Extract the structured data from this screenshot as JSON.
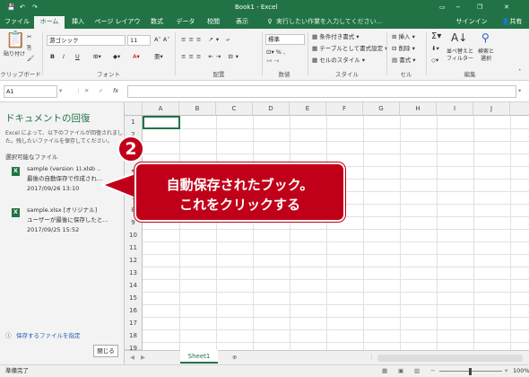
{
  "titlebar": {
    "title": "Book1 - Excel",
    "signin": "サインイン",
    "share": "共有",
    "min": "−",
    "restore": "❐",
    "close": "✕"
  },
  "tabs": [
    "ファイル",
    "ホーム",
    "挿入",
    "ページ レイアウト",
    "数式",
    "データ",
    "校閲",
    "表示"
  ],
  "tell_me": "実行したい作業を入力してください...",
  "ribbon": {
    "paste": "貼り付け",
    "clipboard": "クリップボード",
    "font_name": "游ゴシック",
    "font_size": "11",
    "bold": "B",
    "italic": "I",
    "underline": "U",
    "font": "フォント",
    "alignment": "配置",
    "number_format": "標準",
    "number": "数値",
    "cond_format": "条件付き書式",
    "table_format": "テーブルとして書式設定",
    "cell_style": "セルのスタイル",
    "style": "スタイル",
    "insert": "挿入",
    "delete": "削除",
    "format": "書式",
    "cells": "セル",
    "sort_filter": "並べ替えと\nフィルター",
    "find_select": "検索と\n選択",
    "editing": "編集"
  },
  "formula_bar": {
    "name_box": "A1",
    "cancel": "✕",
    "enter": "✓",
    "fx": "fx",
    "value": ""
  },
  "recovery": {
    "title": "ドキュメントの回復",
    "desc1": "Excel によって、以下のファイルが回復されまし",
    "desc2": "た。残したいファイルを保存してください。",
    "available": "選択可能なファイル",
    "files": [
      {
        "name": "sample (version 1).xlsb ..",
        "desc": "最後の自動保存で作成され...",
        "date": "2017/09/26 13:10"
      },
      {
        "name": "sample.xlsx  [オリジナル]",
        "desc": "ユーザーが最後に保存したと...",
        "date": "2017/09/25 15:52"
      }
    ],
    "which_link": "保存するファイルを指定",
    "close": "閉じる"
  },
  "grid": {
    "columns": [
      "A",
      "B",
      "C",
      "D",
      "E",
      "F",
      "G",
      "H",
      "I",
      "J"
    ],
    "rows": [
      "1",
      "2",
      "3",
      "4",
      "5",
      "6",
      "7",
      "8",
      "9",
      "10",
      "11",
      "12",
      "13",
      "14",
      "15",
      "16",
      "17",
      "18",
      "19"
    ]
  },
  "sheet_tab": "Sheet1",
  "status": {
    "ready": "準備完了",
    "zoom": "100%"
  },
  "callout": {
    "badge": "2",
    "line1": "自動保存されたブック。",
    "line2": "これをクリックする"
  },
  "colors": {
    "excel_green": "#217346",
    "callout_red": "#c00018"
  }
}
